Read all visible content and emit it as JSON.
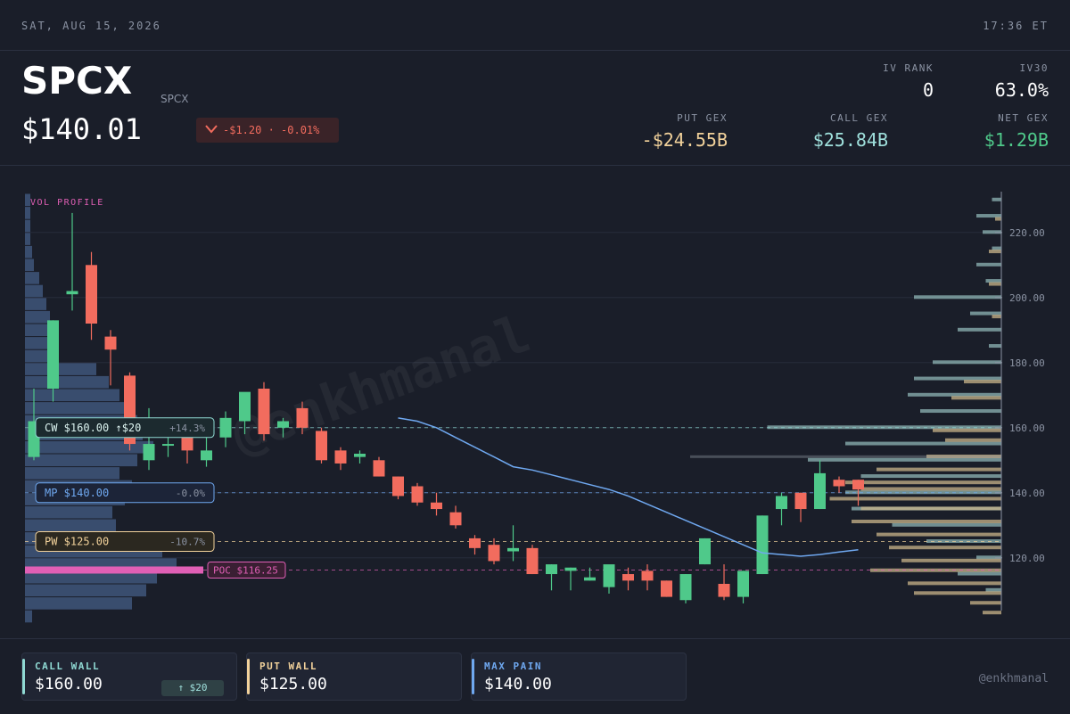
{
  "topbar": {
    "date": "SAT, AUG 15, 2026",
    "time": "17:36 ET"
  },
  "header": {
    "ticker": "SPCX",
    "subtitle": "SPCX",
    "price": "$140.01",
    "change": "-$1.20 · -0.01%",
    "stats": {
      "iv_rank": {
        "label": "IV RANK",
        "value": "0"
      },
      "iv30": {
        "label": "IV30",
        "value": "63.0%"
      },
      "put_gex": {
        "label": "PUT GEX",
        "value": "-$24.55B"
      },
      "call_gex": {
        "label": "CALL GEX",
        "value": "$25.84B"
      },
      "net_gex": {
        "label": "NET GEX",
        "value": "$1.29B"
      }
    }
  },
  "colors": {
    "up": "#4fc98a",
    "down": "#f26c5e",
    "call": "#8fd9d3",
    "put": "#f2d29b",
    "maxpain": "#6fa8f0",
    "poc": "#e05fb5",
    "profile": "#3d5276",
    "ma": "#6fa8f0"
  },
  "chart_data": {
    "type": "candlestick",
    "title": "",
    "y_ticks": [
      120,
      140,
      160,
      180,
      200,
      220
    ],
    "y_tick_labels": [
      "120.00",
      "140.00",
      "160.00",
      "180.00",
      "200.00",
      "220.00"
    ],
    "ylim": [
      101,
      232
    ],
    "candles": [
      {
        "o": 151,
        "h": 172,
        "l": 150,
        "c": 162
      },
      {
        "o": 172,
        "h": 193,
        "l": 168,
        "c": 193
      },
      {
        "o": 201,
        "h": 226,
        "l": 196,
        "c": 202
      },
      {
        "o": 210,
        "h": 214,
        "l": 187,
        "c": 192
      },
      {
        "o": 188,
        "h": 190,
        "l": 173,
        "c": 184
      },
      {
        "o": 176,
        "h": 177,
        "l": 153,
        "c": 155
      },
      {
        "o": 150,
        "h": 166,
        "l": 147,
        "c": 155
      },
      {
        "o": 155,
        "h": 157,
        "l": 151,
        "c": 155
      },
      {
        "o": 157,
        "h": 160,
        "l": 149,
        "c": 153
      },
      {
        "o": 150,
        "h": 157,
        "l": 148,
        "c": 153
      },
      {
        "o": 157,
        "h": 165,
        "l": 154,
        "c": 163
      },
      {
        "o": 162,
        "h": 170,
        "l": 158,
        "c": 171
      },
      {
        "o": 172,
        "h": 174,
        "l": 156,
        "c": 158
      },
      {
        "o": 160,
        "h": 163,
        "l": 157,
        "c": 162
      },
      {
        "o": 166,
        "h": 168,
        "l": 158,
        "c": 160
      },
      {
        "o": 159,
        "h": 160,
        "l": 149,
        "c": 150
      },
      {
        "o": 153,
        "h": 154,
        "l": 147,
        "c": 149
      },
      {
        "o": 151,
        "h": 153,
        "l": 149,
        "c": 152
      },
      {
        "o": 150,
        "h": 151,
        "l": 145,
        "c": 145
      },
      {
        "o": 145,
        "h": 145,
        "l": 138,
        "c": 139
      },
      {
        "o": 142,
        "h": 143,
        "l": 136,
        "c": 137
      },
      {
        "o": 137,
        "h": 140,
        "l": 133,
        "c": 135
      },
      {
        "o": 134,
        "h": 136,
        "l": 129,
        "c": 130
      },
      {
        "o": 126,
        "h": 127,
        "l": 121,
        "c": 123
      },
      {
        "o": 124,
        "h": 126,
        "l": 118,
        "c": 119
      },
      {
        "o": 122,
        "h": 130,
        "l": 119,
        "c": 123
      },
      {
        "o": 123,
        "h": 124,
        "l": 115,
        "c": 115
      },
      {
        "o": 115,
        "h": 118,
        "l": 110,
        "c": 118
      },
      {
        "o": 116,
        "h": 117,
        "l": 110,
        "c": 117
      },
      {
        "o": 113,
        "h": 117,
        "l": 113,
        "c": 114
      },
      {
        "o": 111,
        "h": 117,
        "l": 109,
        "c": 118
      },
      {
        "o": 115,
        "h": 117,
        "l": 110,
        "c": 113
      },
      {
        "o": 116,
        "h": 118,
        "l": 110,
        "c": 113
      },
      {
        "o": 113,
        "h": 113,
        "l": 108,
        "c": 108
      },
      {
        "o": 107,
        "h": 115,
        "l": 106,
        "c": 115
      },
      {
        "o": 118,
        "h": 126,
        "l": 118,
        "c": 126
      },
      {
        "o": 112,
        "h": 118,
        "l": 107,
        "c": 108
      },
      {
        "o": 108,
        "h": 116,
        "l": 106,
        "c": 116
      },
      {
        "o": 115,
        "h": 133,
        "l": 115,
        "c": 133
      },
      {
        "o": 135,
        "h": 140,
        "l": 130,
        "c": 139
      },
      {
        "o": 140,
        "h": 140,
        "l": 131,
        "c": 135
      },
      {
        "o": 135,
        "h": 150,
        "l": 135,
        "c": 146
      },
      {
        "o": 144,
        "h": 145,
        "l": 140,
        "c": 142
      },
      {
        "o": 144,
        "h": 144,
        "l": 136,
        "c": 141
      }
    ],
    "ma_line": [
      {
        "i": 19,
        "v": 163
      },
      {
        "i": 20,
        "v": 162
      },
      {
        "i": 21,
        "v": 160
      },
      {
        "i": 22,
        "v": 157
      },
      {
        "i": 23,
        "v": 154
      },
      {
        "i": 24,
        "v": 151
      },
      {
        "i": 25,
        "v": 148
      },
      {
        "i": 26,
        "v": 147
      },
      {
        "i": 27,
        "v": 145.5
      },
      {
        "i": 28,
        "v": 144
      },
      {
        "i": 29,
        "v": 142.5
      },
      {
        "i": 30,
        "v": 141
      },
      {
        "i": 31,
        "v": 139
      },
      {
        "i": 32,
        "v": 136.5
      },
      {
        "i": 33,
        "v": 134
      },
      {
        "i": 34,
        "v": 131.5
      },
      {
        "i": 35,
        "v": 129
      },
      {
        "i": 36,
        "v": 126.5
      },
      {
        "i": 37,
        "v": 124
      },
      {
        "i": 38,
        "v": 121.5
      },
      {
        "i": 39,
        "v": 121
      },
      {
        "i": 40,
        "v": 120.5
      },
      {
        "i": 41,
        "v": 121
      },
      {
        "i": 42,
        "v": 121.8
      },
      {
        "i": 43,
        "v": 122.5
      }
    ],
    "levels": [
      {
        "name": "cw",
        "price": 160,
        "label": "CW $160.00 ↑$20",
        "pct": "+14.3%"
      },
      {
        "name": "mp",
        "price": 140,
        "label": "MP $140.00",
        "pct": "-0.0%"
      },
      {
        "name": "pw",
        "price": 125,
        "label": "PW $125.00",
        "pct": "-10.7%"
      },
      {
        "name": "poc",
        "price": 116.25,
        "label": "POC $116.25"
      }
    ],
    "vol_profile": {
      "label": "VOL PROFILE",
      "bins": [
        {
          "p": 230,
          "v": 0.02
        },
        {
          "p": 226,
          "v": 0.02
        },
        {
          "p": 222,
          "v": 0.02
        },
        {
          "p": 218,
          "v": 0.02
        },
        {
          "p": 214,
          "v": 0.04
        },
        {
          "p": 210,
          "v": 0.05
        },
        {
          "p": 206,
          "v": 0.08
        },
        {
          "p": 202,
          "v": 0.1
        },
        {
          "p": 198,
          "v": 0.12
        },
        {
          "p": 194,
          "v": 0.14
        },
        {
          "p": 190,
          "v": 0.15
        },
        {
          "p": 186,
          "v": 0.17
        },
        {
          "p": 182,
          "v": 0.19
        },
        {
          "p": 178,
          "v": 0.4
        },
        {
          "p": 174,
          "v": 0.47
        },
        {
          "p": 170,
          "v": 0.53
        },
        {
          "p": 166,
          "v": 0.6
        },
        {
          "p": 162,
          "v": 0.63
        },
        {
          "p": 158,
          "v": 0.66
        },
        {
          "p": 154,
          "v": 0.72
        },
        {
          "p": 150,
          "v": 0.63
        },
        {
          "p": 146,
          "v": 0.53
        },
        {
          "p": 142,
          "v": 0.6
        },
        {
          "p": 138,
          "v": 0.56
        },
        {
          "p": 134,
          "v": 0.49
        },
        {
          "p": 130,
          "v": 0.51
        },
        {
          "p": 126,
          "v": 0.58
        },
        {
          "p": 122,
          "v": 0.77
        },
        {
          "p": 118,
          "v": 0.85
        },
        {
          "p": 114,
          "v": 0.74
        },
        {
          "p": 110,
          "v": 0.68
        },
        {
          "p": 106,
          "v": 0.6
        },
        {
          "p": 102,
          "v": 0.04
        }
      ]
    },
    "gex_profile": {
      "calls": [
        {
          "p": 230,
          "v": 3
        },
        {
          "p": 225,
          "v": 8
        },
        {
          "p": 220,
          "v": 6
        },
        {
          "p": 215,
          "v": 3
        },
        {
          "p": 210,
          "v": 8
        },
        {
          "p": 205,
          "v": 5
        },
        {
          "p": 200,
          "v": 28
        },
        {
          "p": 195,
          "v": 10
        },
        {
          "p": 190,
          "v": 14
        },
        {
          "p": 185,
          "v": 4
        },
        {
          "p": 180,
          "v": 22
        },
        {
          "p": 175,
          "v": 28
        },
        {
          "p": 170,
          "v": 30
        },
        {
          "p": 165,
          "v": 26
        },
        {
          "p": 160,
          "v": 75
        },
        {
          "p": 155,
          "v": 50
        },
        {
          "p": 150,
          "v": 62
        },
        {
          "p": 145,
          "v": 45
        },
        {
          "p": 140,
          "v": 50
        },
        {
          "p": 135,
          "v": 48
        },
        {
          "p": 130,
          "v": 35
        },
        {
          "p": 125,
          "v": 24
        },
        {
          "p": 120,
          "v": 8
        },
        {
          "p": 115,
          "v": 14
        },
        {
          "p": 110,
          "v": 5
        }
      ],
      "puts": [
        {
          "p": 225,
          "v": 2
        },
        {
          "p": 215,
          "v": 4
        },
        {
          "p": 205,
          "v": 4
        },
        {
          "p": 195,
          "v": 3
        },
        {
          "p": 175,
          "v": 12
        },
        {
          "p": 170,
          "v": 16
        },
        {
          "p": 160,
          "v": 22
        },
        {
          "p": 157,
          "v": 18
        },
        {
          "p": 152,
          "v": 24
        },
        {
          "p": 148,
          "v": 40
        },
        {
          "p": 144,
          "v": 50
        },
        {
          "p": 142,
          "v": 45
        },
        {
          "p": 139,
          "v": 55
        },
        {
          "p": 136,
          "v": 45
        },
        {
          "p": 132,
          "v": 48
        },
        {
          "p": 128,
          "v": 40
        },
        {
          "p": 124,
          "v": 36
        },
        {
          "p": 120,
          "v": 32
        },
        {
          "p": 117,
          "v": 42
        },
        {
          "p": 113,
          "v": 30
        },
        {
          "p": 110,
          "v": 28
        },
        {
          "p": 107,
          "v": 10
        },
        {
          "p": 104,
          "v": 6
        }
      ]
    },
    "watermark": "@enkhmanal"
  },
  "footer": {
    "call_wall": {
      "label": "CALL WALL",
      "value": "$160.00",
      "badge": "↑ $20"
    },
    "put_wall": {
      "label": "PUT WALL",
      "value": "$125.00"
    },
    "max_pain": {
      "label": "MAX PAIN",
      "value": "$140.00"
    },
    "handle": "@enkhmanal"
  }
}
